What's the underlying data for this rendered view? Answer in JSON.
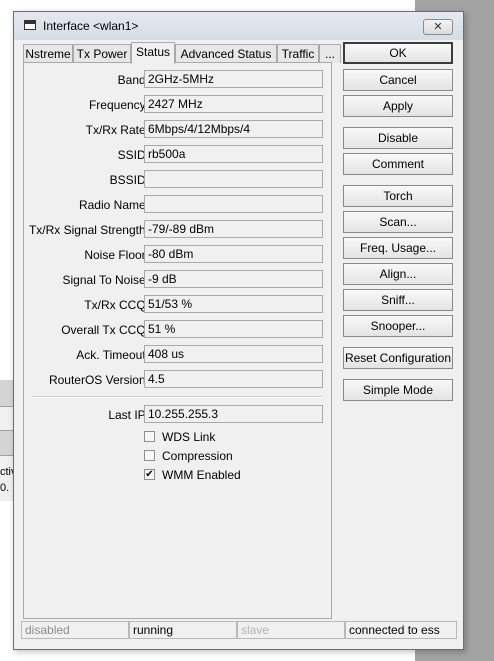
{
  "window": {
    "title": "Interface <wlan1>",
    "close_glyph": "✕"
  },
  "background": {
    "fragment1": "ctiv",
    "fragment2": "0."
  },
  "tabs": [
    {
      "label": "Nstreme",
      "active": false
    },
    {
      "label": "Tx Power",
      "active": false
    },
    {
      "label": "Status",
      "active": true
    },
    {
      "label": "Advanced Status",
      "active": false
    },
    {
      "label": "Traffic",
      "active": false
    },
    {
      "label": "...",
      "active": false
    }
  ],
  "status_fields": [
    {
      "label": "Band:",
      "value": "2GHz-5MHz"
    },
    {
      "label": "Frequency:",
      "value": "2427 MHz"
    },
    {
      "label": "Tx/Rx Rate:",
      "value": "6Mbps/4/12Mbps/4"
    },
    {
      "label": "SSID:",
      "value": "rb500a"
    },
    {
      "label": "BSSID:",
      "value": ""
    },
    {
      "label": "Radio Name:",
      "value": ""
    },
    {
      "label": "Tx/Rx Signal Strength:",
      "value": "-79/-89 dBm"
    },
    {
      "label": "Noise Floor:",
      "value": "-80 dBm"
    },
    {
      "label": "Signal To Noise:",
      "value": "-9 dB"
    },
    {
      "label": "Tx/Rx CCQ:",
      "value": "51/53 %"
    },
    {
      "label": "Overall Tx CCQ:",
      "value": "51 %"
    },
    {
      "label": "Ack. Timeout:",
      "value": "408 us"
    },
    {
      "label": "RouterOS Version:",
      "value": "4.5"
    }
  ],
  "last_ip": {
    "label": "Last IP:",
    "value": "10.255.255.3"
  },
  "checkboxes": [
    {
      "label": "WDS Link",
      "checked": false,
      "mark": ""
    },
    {
      "label": "Compression",
      "checked": false,
      "mark": ""
    },
    {
      "label": "WMM Enabled",
      "checked": true,
      "mark": "✔"
    }
  ],
  "buttons": {
    "ok": "OK",
    "cancel": "Cancel",
    "apply": "Apply",
    "disable": "Disable",
    "comment": "Comment",
    "torch": "Torch",
    "scan": "Scan...",
    "freq_usage": "Freq. Usage...",
    "align": "Align...",
    "sniff": "Sniff...",
    "snooper": "Snooper...",
    "reset_configuration": "Reset Configuration",
    "simple_mode": "Simple Mode"
  },
  "statusbar": {
    "state": "disabled",
    "running": "running",
    "role": "slave",
    "connection": "connected to ess"
  }
}
